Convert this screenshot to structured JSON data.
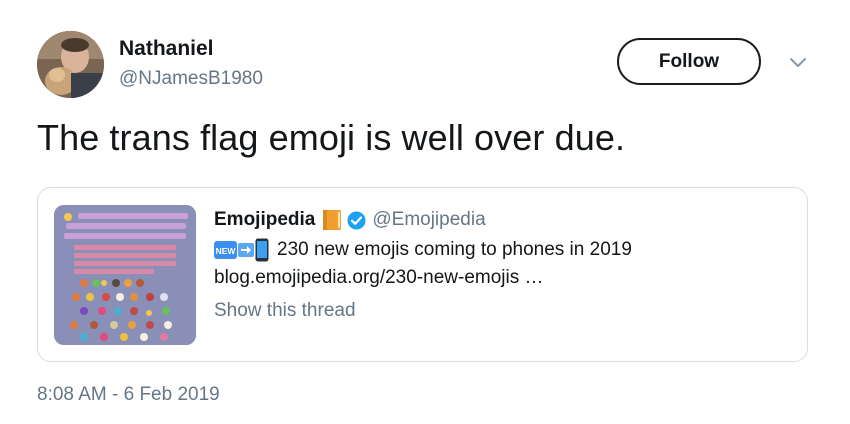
{
  "author": {
    "name": "Nathaniel",
    "handle": "@NJamesB1980",
    "avatar_icon": "profile-photo"
  },
  "actions": {
    "follow_label": "Follow",
    "more_icon": "chevron-down-icon"
  },
  "tweet": {
    "text": "The trans flag emoji is well over due.",
    "timestamp": "8:08 AM - 6 Feb 2019"
  },
  "quoted_tweet": {
    "author_name": "Emojipedia",
    "author_handle": "@Emojipedia",
    "badge_icons": [
      "orange-book-icon",
      "verified-badge-icon"
    ],
    "prefix_icons": [
      "new-button-icon",
      "right-arrow-icon",
      "mobile-phone-icon"
    ],
    "text_line1": "230 new emojis coming to phones in 2019",
    "text_line2": "blog.emojipedia.org/230-new-emojis  …",
    "show_thread_label": "Show this thread",
    "thumbnail_icon": "emoji-grid-preview"
  },
  "colors": {
    "text_primary": "#14171a",
    "text_secondary": "#657786",
    "border": "#d7dde2",
    "verified_blue": "#1da1f2",
    "new_badge_blue": "#3c8ff0",
    "book_orange": "#f0a030",
    "thumbnail_bg": "#8a8fb8"
  }
}
